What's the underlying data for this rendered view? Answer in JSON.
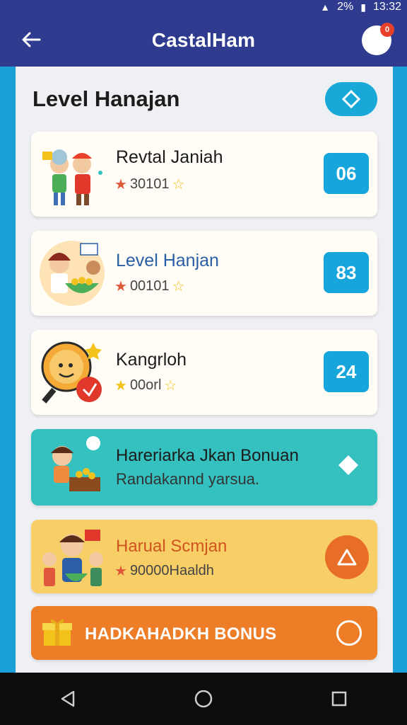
{
  "status_bar": {
    "battery": "2%",
    "time": "13:32"
  },
  "app_bar": {
    "title": "CastalHam",
    "badge": "0"
  },
  "section": {
    "title": "Level Hanajan"
  },
  "cards": [
    {
      "title": "Revtal Janiah",
      "meta": "30101",
      "badge": "06",
      "title_color": "#1c1c1c"
    },
    {
      "title": "Level Hanjan",
      "meta": "00101",
      "badge": "83",
      "title_color": "#2a5fa5"
    },
    {
      "title": "Kangrloh",
      "meta": "00orl",
      "badge": "24",
      "title_color": "#1c1c1c"
    }
  ],
  "promo_teal": {
    "title": "Hareriarka Jkan Bonuan",
    "subtitle": "Randakannd yarsua."
  },
  "promo_yellow": {
    "title": "Harual Scmjan",
    "meta": "90000Haaldh"
  },
  "cta": {
    "label": "HADKAHADKH BONUS"
  },
  "icons": {
    "back": "arrow-left-icon",
    "avatar": "avatar",
    "section_action": "diamond-icon",
    "nav": [
      "back-triangle-icon",
      "home-circle-icon",
      "recents-square-icon"
    ]
  }
}
